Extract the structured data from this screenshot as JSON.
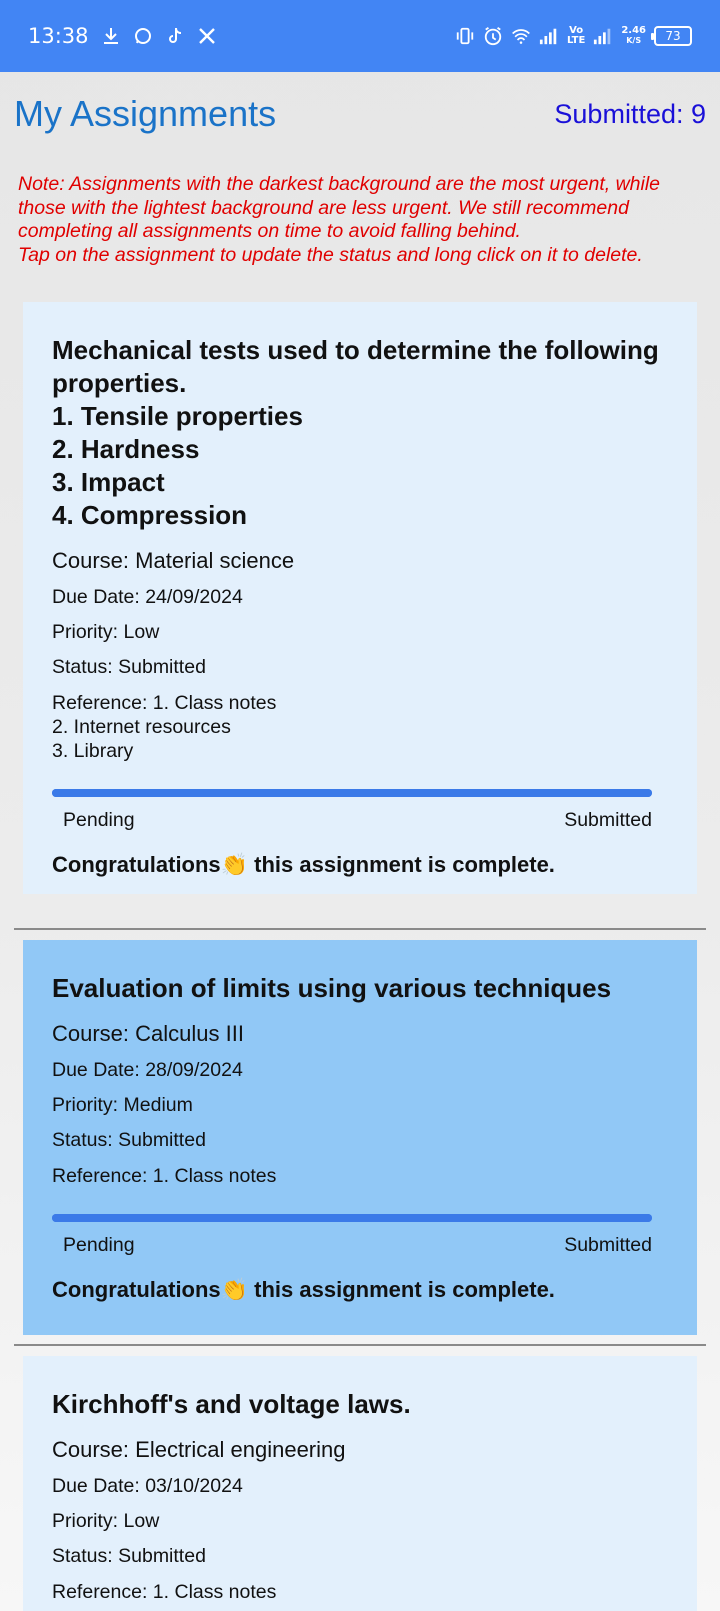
{
  "status_bar": {
    "time": "13:38",
    "left_icons": [
      "download-icon",
      "whatsapp-icon",
      "tiktok-icon",
      "x-icon"
    ],
    "volte": "Vo\nLTE",
    "net_speed": "2.46",
    "net_unit": "K/S",
    "battery": "73"
  },
  "header": {
    "title": "My Assignments",
    "submitted": "Submitted: 9"
  },
  "note": "Note: Assignments with the darkest background are the most urgent, while those with the lightest background are less urgent. We still recommend completing all assignments on time to avoid falling behind.\nTap on the assignment to update the status and long click on it to delete.",
  "colors": {
    "status_bar": "#4285f4",
    "title": "#1a73c8",
    "submitted": "#1a10d8",
    "note": "#e00000",
    "card_low": "#e3f0fc",
    "card_medium": "#91c8f6",
    "progress": "#3b7ae8"
  },
  "assignments": [
    {
      "title": "Mechanical tests used to determine the following properties.\n1. Tensile properties\n2. Hardness\n3. Impact\n4. Compression",
      "course": "Course: Material science",
      "due": "Due Date: 24/09/2024",
      "priority": "Priority: Low",
      "status": "Status: Submitted",
      "reference": "Reference: 1. Class notes\n2. Internet resources\n3. Library",
      "progress": 1.0,
      "progress_start": "Pending",
      "progress_end": "Submitted",
      "message": "Congratulations👏 this assignment is complete."
    },
    {
      "title": "Evaluation of limits using various techniques",
      "course": "Course: Calculus III",
      "due": "Due Date: 28/09/2024",
      "priority": "Priority: Medium",
      "status": "Status: Submitted",
      "reference": "Reference: 1. Class notes",
      "progress": 1.0,
      "progress_start": "Pending",
      "progress_end": "Submitted",
      "message": "Congratulations👏 this assignment is complete."
    },
    {
      "title": "Kirchhoff's and voltage laws.",
      "course": "Course: Electrical engineering",
      "due": "Due Date: 03/10/2024",
      "priority": "Priority: Low",
      "status": "Status: Submitted",
      "reference": "Reference: 1. Class notes"
    }
  ]
}
